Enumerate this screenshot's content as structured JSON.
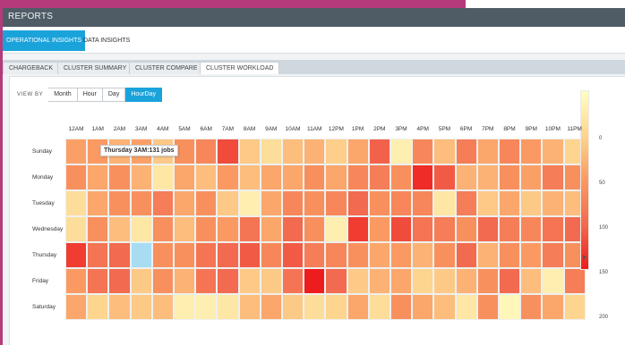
{
  "header": {
    "title": "REPORTS"
  },
  "topnav": {
    "tabs": [
      {
        "label": "OPERATIONAL INSIGHTS",
        "active": true
      },
      {
        "label": "DATA INSIGHTS",
        "active": false
      }
    ]
  },
  "subnav": {
    "tabs": [
      {
        "label": "CHARGEBACK",
        "active": false
      },
      {
        "label": "CLUSTER SUMMARY",
        "active": false
      },
      {
        "label": "CLUSTER COMPARE",
        "active": false
      },
      {
        "label": "CLUSTER WORKLOAD",
        "active": true
      }
    ]
  },
  "viewby": {
    "label": "VIEW BY",
    "options": [
      {
        "label": "Month",
        "active": false
      },
      {
        "label": "Hour",
        "active": false
      },
      {
        "label": "Day",
        "active": false
      },
      {
        "label": "HourDay",
        "active": true
      }
    ]
  },
  "tooltip": "Thursday 3AM:131 jobs",
  "colors": {
    "accent": "#1aa3db",
    "header": "#4f5c66",
    "low": "#ffffc4",
    "high": "#ee1d1d",
    "highlight": "#a7dcf2"
  },
  "chart_data": {
    "type": "heatmap",
    "title": "",
    "x": [
      "12AM",
      "1AM",
      "2AM",
      "3AM",
      "4AM",
      "5AM",
      "6AM",
      "7AM",
      "8AM",
      "9AM",
      "10AM",
      "11AM",
      "12PM",
      "1PM",
      "2PM",
      "3PM",
      "4PM",
      "5PM",
      "6PM",
      "7PM",
      "8PM",
      "9PM",
      "10PM",
      "11PM"
    ],
    "y": [
      "Sunday",
      "Monday",
      "Tuesday",
      "Wednesday",
      "Thursday",
      "Friday",
      "Saturday"
    ],
    "values": [
      [
        95,
        100,
        80,
        95,
        60,
        110,
        120,
        170,
        60,
        40,
        70,
        80,
        55,
        90,
        155,
        20,
        120,
        70,
        130,
        90,
        120,
        100,
        80,
        50
      ],
      [
        110,
        90,
        110,
        80,
        30,
        90,
        70,
        100,
        70,
        90,
        90,
        110,
        90,
        120,
        130,
        110,
        190,
        160,
        80,
        80,
        110,
        95,
        130,
        110
      ],
      [
        40,
        90,
        110,
        110,
        130,
        90,
        110,
        60,
        20,
        90,
        120,
        110,
        120,
        150,
        110,
        120,
        120,
        30,
        130,
        60,
        90,
        60,
        80,
        70
      ],
      [
        40,
        110,
        70,
        30,
        110,
        70,
        110,
        100,
        140,
        90,
        150,
        110,
        20,
        180,
        100,
        170,
        140,
        130,
        110,
        150,
        130,
        120,
        140,
        150
      ],
      [
        180,
        140,
        150,
        131,
        110,
        110,
        140,
        150,
        160,
        120,
        160,
        130,
        120,
        110,
        90,
        100,
        80,
        110,
        150,
        80,
        110,
        100,
        130,
        110
      ],
      [
        100,
        140,
        150,
        60,
        110,
        80,
        140,
        150,
        60,
        60,
        140,
        200,
        150,
        60,
        80,
        90,
        50,
        60,
        80,
        110,
        150,
        70,
        20,
        130
      ],
      [
        90,
        50,
        70,
        60,
        70,
        20,
        20,
        30,
        70,
        90,
        60,
        40,
        50,
        90,
        40,
        110,
        90,
        70,
        30,
        110,
        10,
        110,
        90,
        50
      ]
    ],
    "scale": {
      "min": 0,
      "max": 200,
      "ticks": [
        0,
        50,
        100,
        150,
        200
      ]
    },
    "highlight": {
      "day": "Thursday",
      "hour": "3AM",
      "value": 131
    }
  }
}
